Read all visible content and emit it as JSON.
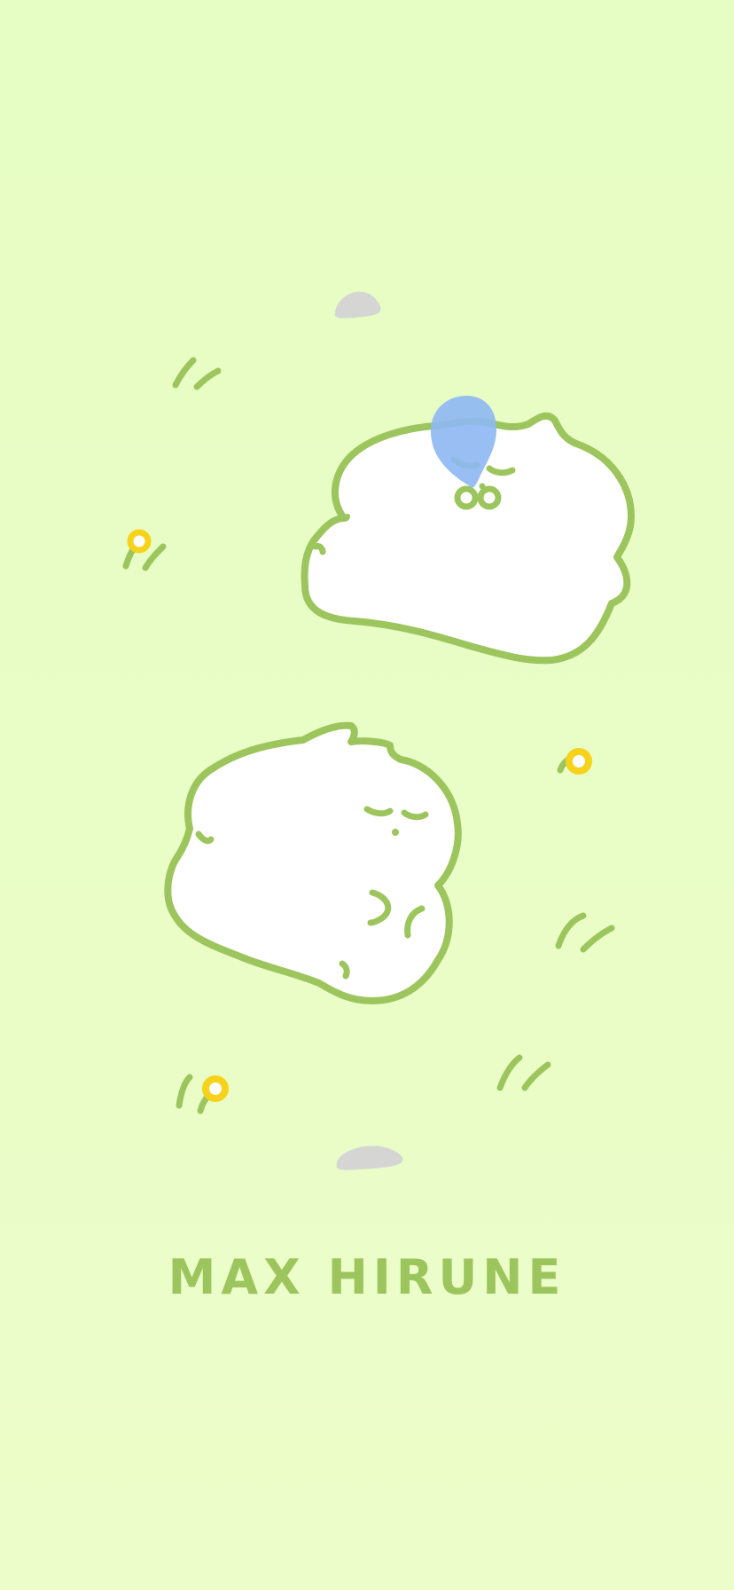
{
  "wallpaper": {
    "title": "MAX HIRUNE",
    "colors": {
      "background": "#e6fdc3",
      "outline": "#9dc55d",
      "body": "#ffffff",
      "bubble": "#8fb8f2",
      "flower": "#f6d21b",
      "stone": "#d5d6d3"
    },
    "icons": [
      "sleeping-blob-top",
      "sleeping-blob-bottom",
      "snot-bubble-icon",
      "flower-icon",
      "grass-tuft-icon",
      "stone-icon"
    ]
  }
}
